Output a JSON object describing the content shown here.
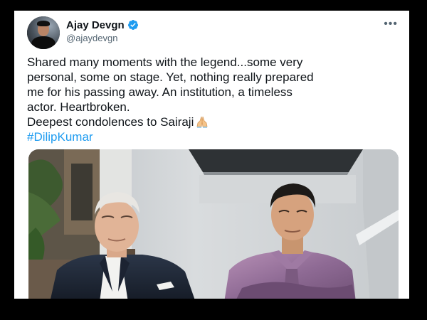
{
  "tweet": {
    "author_name": "Ajay Devgn",
    "author_handle": "@ajaydevgn",
    "more_icon": "ellipsis-icon",
    "verified_icon": "verified-badge-icon",
    "lines": [
      "Shared many moments with the legend...some very",
      "personal, some on stage. Yet, nothing really prepared",
      "me for his passing away. An institution, a timeless",
      "actor. Heartbroken.",
      "Deepest condolences to Sairaji"
    ],
    "emoji": "folded-hands-emoji",
    "hashtag": "#DilipKumar",
    "media": "photo-two-men-standing"
  },
  "colors": {
    "text": "#0f1419",
    "secondary": "#536471",
    "link": "#1d9bf0",
    "verified": "#1d9bf0",
    "frame": "#000000"
  }
}
